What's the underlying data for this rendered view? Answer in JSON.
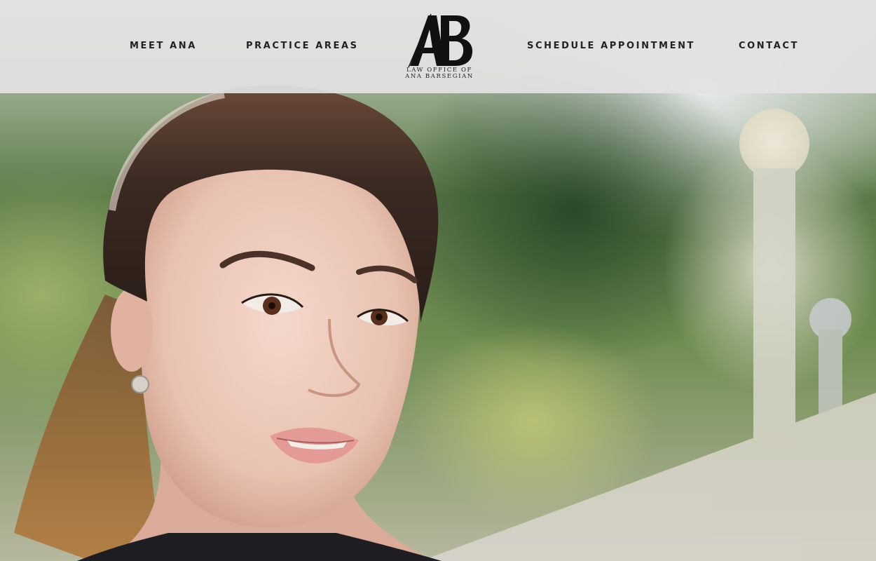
{
  "nav": {
    "left": [
      "MEET ANA",
      "PRACTICE AREAS"
    ],
    "right": [
      "SCHEDULE APPOINTMENT",
      "CONTACT"
    ]
  },
  "logo": {
    "monogram": "AB",
    "line1": "LAW OFFICE OF",
    "line2": "ANA BARSEGIAN"
  },
  "hero": {
    "image": "portrait-photo"
  },
  "colors": {
    "header_bg": "#e2e2e2",
    "nav_text": "#222222"
  }
}
